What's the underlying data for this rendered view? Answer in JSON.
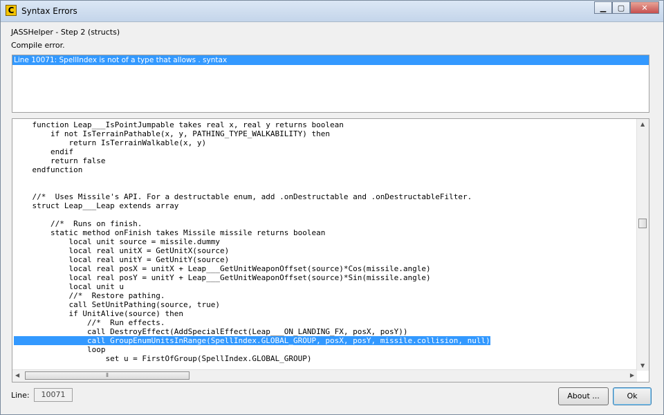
{
  "window": {
    "title": "Syntax Errors",
    "app_icon": "C"
  },
  "caption": {
    "minimize": "▁",
    "maximize": "▢",
    "close": "✕"
  },
  "header": {
    "step": "JASSHelper - Step 2 (structs)",
    "status": "Compile error."
  },
  "errors": [
    "Line 10071: SpellIndex is not of a type that allows . syntax"
  ],
  "code": {
    "lines": [
      "    function Leap___IsPointJumpable takes real x, real y returns boolean",
      "        if not IsTerrainPathable(x, y, PATHING_TYPE_WALKABILITY) then",
      "            return IsTerrainWalkable(x, y)",
      "        endif",
      "        return false",
      "    endfunction",
      "",
      "",
      "    //*  Uses Missile's API. For a destructable enum, add .onDestructable and .onDestructableFilter.",
      "    struct Leap___Leap extends array",
      "",
      "        //*  Runs on finish.",
      "        static method onFinish takes Missile missile returns boolean",
      "            local unit source = missile.dummy",
      "            local real unitX = GetUnitX(source)",
      "            local real unitY = GetUnitY(source)",
      "            local real posX = unitX + Leap___GetUnitWeaponOffset(source)*Cos(missile.angle)",
      "            local real posY = unitY + Leap___GetUnitWeaponOffset(source)*Sin(missile.angle)",
      "            local unit u",
      "            //*  Restore pathing.",
      "            call SetUnitPathing(source, true)",
      "            if UnitAlive(source) then",
      "                //*  Run effects.",
      "                call DestroyEffect(AddSpecialEffect(Leap___ON_LANDING_FX, posX, posY))",
      "                call GroupEnumUnitsInRange(SpellIndex.GLOBAL_GROUP, posX, posY, missile.collision, null)",
      "                loop",
      "                    set u = FirstOfGroup(SpellIndex.GLOBAL_GROUP)"
    ],
    "selected_line": 24
  },
  "footer": {
    "line_label": "Line:",
    "line_value": "10071",
    "about_label": "About ...",
    "ok_label": "Ok"
  },
  "colors": {
    "selection": "#3399ff",
    "window_bg": "#f0f0f0"
  }
}
